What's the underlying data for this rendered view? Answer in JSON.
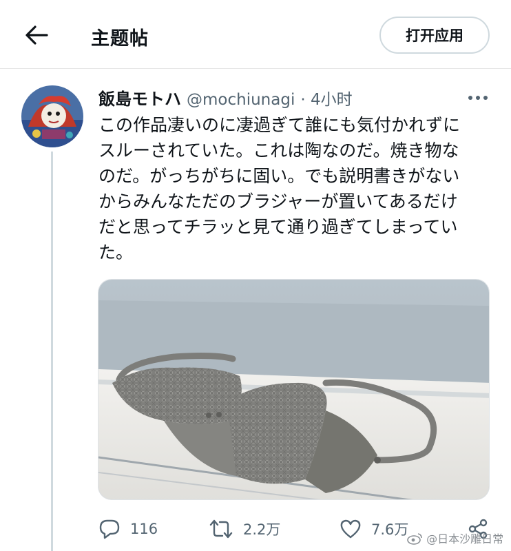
{
  "header": {
    "back_icon": "arrow-left-icon",
    "title": "主题帖",
    "open_app_label": "打开应用"
  },
  "tweet": {
    "display_name": "飯島モトハ",
    "handle": "@mochiunagi",
    "time": "· 4小时",
    "text": "この作品凄いのに凄過ぎて誰にも気付かれずに\nスルーされていた。これは陶なのだ。焼き物な\nのだ。がっちがちに固い。でも説明書きがない\nからみんなただのブラジャーが置いてあるだけ\nだと思ってチラッと見て通り過ぎてしまってい\nた。",
    "more_icon": "more-horizontal-icon",
    "media_description_icon": "image",
    "actions": {
      "reply_count": "116",
      "retweet_count": "2.2万",
      "like_count": "7.6万"
    }
  },
  "watermark": {
    "text": "@日本沙雕日常"
  },
  "colors": {
    "text_primary": "#0f1419",
    "text_secondary": "#536471",
    "border": "#cfd9de"
  }
}
